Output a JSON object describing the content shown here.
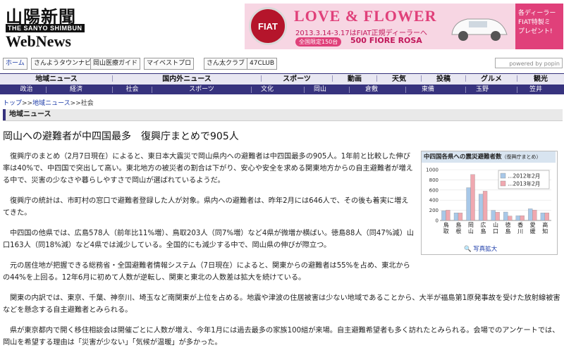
{
  "logo": {
    "name": "山陽新聞",
    "sub": "THE SANYO SHIMBUN",
    "web": "WebNews"
  },
  "banner": {
    "brand": "FIAT",
    "title": "LOVE & FLOWER",
    "line1": "2013.3.14-3.17はFIAT正規ディーラーへ",
    "pill": "全国限定150台",
    "line3": "500 FIORE ROSA",
    "side": [
      "各ディーラー",
      "FIAT特製ミ",
      "プレゼント!"
    ]
  },
  "links": [
    "ホーム",
    "さんようタウンナビ",
    "岡山医療ガイド",
    "マイベストプロ",
    "さん太クラブ",
    "47CLUB"
  ],
  "search": {
    "placeholder": "powered by popin"
  },
  "nav_main": [
    "地域ニュース",
    "国内外ニュース",
    "スポーツ",
    "動画",
    "天気",
    "投稿",
    "グルメ",
    "観光"
  ],
  "nav_sub": [
    "政治",
    "経済",
    "社会",
    "スポーツ",
    "文化",
    "岡山",
    "倉敷",
    "東備",
    "玉野",
    "笠井"
  ],
  "breadcrumb": {
    "home": "トップ",
    "sep": ">>",
    "section": "地域ニュース",
    "current": "社会"
  },
  "section_label": "地域ニュース",
  "article": {
    "headline": "岡山への避難者が中四国最多　復興庁まとめで905人",
    "paragraphs": [
      "復興庁のまとめ（2月7日現在）によると、東日本大震災で岡山県内への避難者は中四国最多の905人。1年前と比較した伸び率は40%で、中四国で突出して高い。東北地方の被災者の割合は下がり、安心や安全を求める関東地方からの自主避難者が増える中で、災害の少なさや暮らしやすさで岡山が選ばれているようだ。",
      "復興庁の統計は、市町村の窓口で避難者登録した人が対象。県内への避難者は、昨年2月には646人で、その後も着実に増えてきた。",
      "中四国の他県では、広島578人（前年比11%増）、鳥取203人（同7%増）など4県が微増か横ばい。徳島88人（同47%減）山口163人（同18%減）など4県では減少している。全国的にも減少する中で、岡山県の伸びが際立つ。",
      "元の居住地が把握できる総務省・全国避難者情報システム（7日現在）によると、関東からの避難者は55%を占め、東北からの44%を上回る。12年6月に初めて人数が逆転し、関東と東北の人数差は拡大を続けている。",
      "関東の内訳では、東京、千葉、神奈川、埼玉など南関東が上位を占める。地震や津波の住居被害は少ない地域であることから、大半が福島第1原発事故を受けた放射線被害などを懸念する自主避難者とみられる。",
      "県が東京都内で開く移住相談会は開催ごとに人数が増え、今年1月には過去最多の家族100組が来場。自主避難希望者も多く訪れたとみられる。会場でのアンケートでは、岡山を希望する理由は「災害が少ない」「気候が温暖」が多かった。"
    ]
  },
  "figure": {
    "title": "中四国各県への震災避難者数",
    "title_note": "（復興庁まとめ）",
    "photo_link": "写真拡大"
  },
  "chart_data": {
    "type": "bar",
    "categories": [
      "鳥取",
      "島根",
      "岡山",
      "広島",
      "山口",
      "徳島",
      "香川",
      "愛媛",
      "高知"
    ],
    "series": [
      {
        "name": "2012年2月",
        "values": [
          190,
          150,
          646,
          520,
          200,
          166,
          92,
          230,
          150
        ],
        "color": "#a8c8e8"
      },
      {
        "name": "2013年2月",
        "values": [
          203,
          148,
          905,
          578,
          163,
          88,
          95,
          205,
          150
        ],
        "color": "#f0a8b0"
      }
    ],
    "yticks": [
      0,
      200,
      400,
      600,
      800,
      1000
    ],
    "ylim": [
      0,
      1000
    ],
    "legend": "top-right"
  }
}
